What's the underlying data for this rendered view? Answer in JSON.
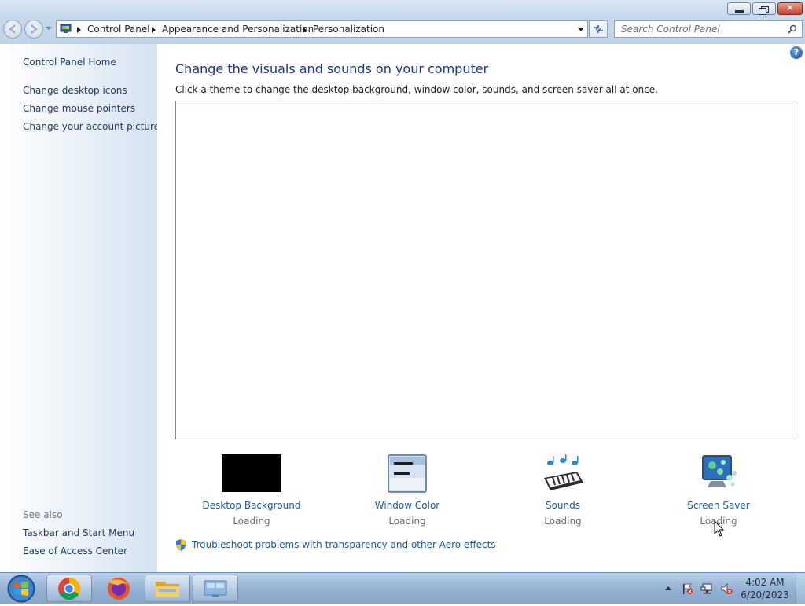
{
  "window": {
    "close_glyph": "✕"
  },
  "address_bar": {
    "crumbs": [
      "Control Panel",
      "Appearance and Personalization",
      "Personalization"
    ]
  },
  "search": {
    "placeholder": "Search Control Panel"
  },
  "left_panel": {
    "home": "Control Panel Home",
    "links": [
      "Change desktop icons",
      "Change mouse pointers",
      "Change your account picture"
    ],
    "see_also_heading": "See also",
    "see_also": [
      "Taskbar and Start Menu",
      "Ease of Access Center"
    ]
  },
  "main": {
    "help_glyph": "?",
    "title": "Change the visuals and sounds on your computer",
    "subtitle": "Click a theme to change the desktop background, window color, sounds, and screen saver all at once.",
    "options": [
      {
        "label": "Desktop Background",
        "status": "Loading",
        "icon": "desktop-background-icon"
      },
      {
        "label": "Window Color",
        "status": "Loading",
        "icon": "window-color-icon"
      },
      {
        "label": "Sounds",
        "status": "Loading",
        "icon": "sounds-icon"
      },
      {
        "label": "Screen Saver",
        "status": "Loading",
        "icon": "screen-saver-icon"
      }
    ],
    "troubleshoot": "Troubleshoot problems with transparency and other Aero effects"
  },
  "taskbar": {
    "apps": [
      "chrome",
      "firefox",
      "windows-explorer",
      "control-panel"
    ],
    "clock_time": "4:02 AM",
    "clock_date": "6/20/2023"
  },
  "colors": {
    "link": "#1e5aa0",
    "title": "#1e3287",
    "nav_link": "#1e395b"
  }
}
